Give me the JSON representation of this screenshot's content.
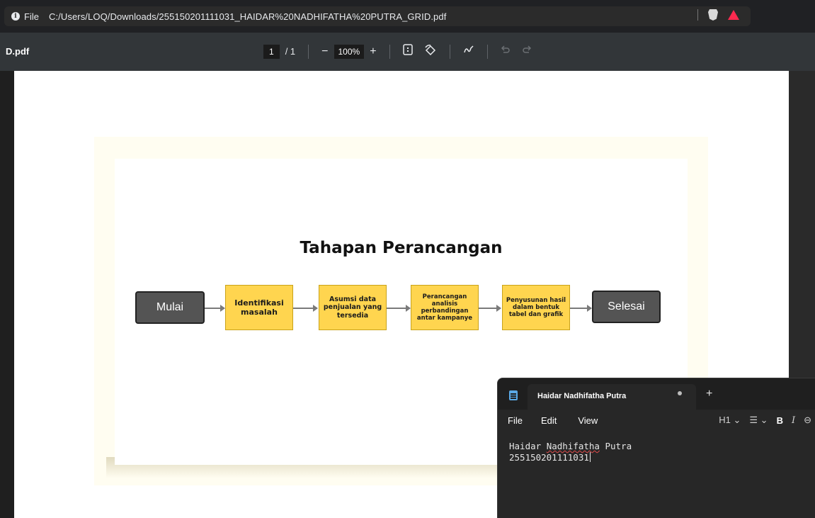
{
  "browser": {
    "file_label": "File",
    "url": "C:/Users/LOQ/Downloads/255150201111031_HAIDAR%20NADHIFATHA%20PUTRA_GRID.pdf",
    "icons": [
      "info-icon",
      "brave-shield-icon",
      "brave-rewards-icon"
    ]
  },
  "pdf_toolbar": {
    "filename": "D.pdf",
    "current_page": "1",
    "page_separator": "/ 1",
    "zoom_out": "−",
    "zoom_level": "100%",
    "zoom_in": "+",
    "icons": [
      "fit-page-icon",
      "rotate-icon",
      "annotate-icon",
      "undo-icon",
      "redo-icon"
    ]
  },
  "slide": {
    "title": "Tahapan Perancangan",
    "start": "Mulai",
    "steps": [
      "Identifikasi masalah",
      "Asumsi data penjualan yang tersedia",
      "Perancangan analisis perbandingan antar kampanye",
      "Penyusunan hasil dalam bentuk tabel dan grafik"
    ],
    "end": "Selesai",
    "colors": {
      "step_fill": "#ffd54f",
      "terminal_fill": "#545454"
    }
  },
  "notepad": {
    "tab_title": "Haidar Nadhifatha Putra",
    "new_tab": "+",
    "menu": [
      "File",
      "Edit",
      "View"
    ],
    "format": {
      "heading": "H1 ⌄",
      "list": "☰ ⌄",
      "bold": "B",
      "italic": "I",
      "link": "⊖"
    },
    "content": {
      "line1_first": "Haidar ",
      "line1_misspelled": "Nadhifatha",
      "line1_rest": " Putra",
      "line2": "255150201111031"
    }
  }
}
